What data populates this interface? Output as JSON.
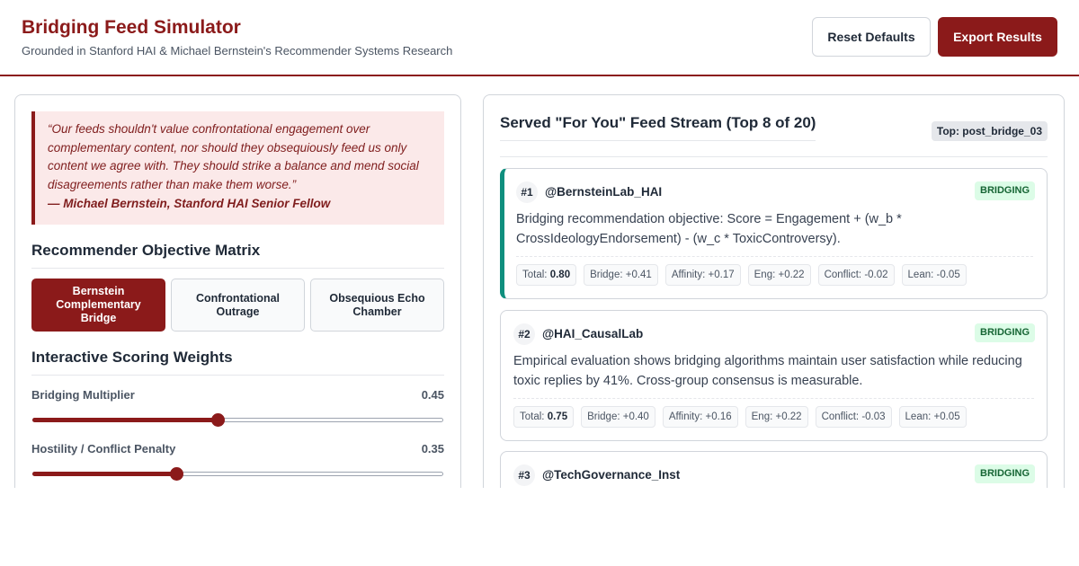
{
  "header": {
    "title": "Bridging Feed Simulator",
    "subtitle": "Grounded in Stanford HAI & Michael Bernstein's Recommender Systems Research",
    "reset_label": "Reset Defaults",
    "export_label": "Export Results"
  },
  "quote": {
    "text": "“Our feeds shouldn't value confrontational engagement over complementary content, nor should they obsequiously feed us only content we agree with. They should strike a balance and mend social disagreements rather than make them worse.”",
    "author": "— Michael Bernstein, Stanford HAI Senior Fellow"
  },
  "objectives": {
    "title": "Recommender Objective Matrix",
    "options": [
      {
        "label": "Bernstein Complementary Bridge",
        "active": true
      },
      {
        "label": "Confrontational Outrage",
        "active": false
      },
      {
        "label": "Obsequious Echo Chamber",
        "active": false
      }
    ]
  },
  "weights": {
    "title": "Interactive Scoring Weights",
    "sliders": [
      {
        "label": "Bridging Multiplier",
        "value": "0.45",
        "fraction": 0.45
      },
      {
        "label": "Hostility / Conflict Penalty",
        "value": "0.35",
        "fraction": 0.35
      }
    ]
  },
  "feed": {
    "title": "Served \"For You\" Feed Stream (Top 8 of 20)",
    "top_badge": "Top: post_bridge_03",
    "posts": [
      {
        "rank": "#1",
        "user": "@BernsteinLab_HAI",
        "badge": "BRIDGING",
        "text": "Bridging recommendation objective: Score = Engagement + (w_b * CrossIdeologyEndorsement) - (w_c * ToxicControversy).",
        "metrics": {
          "total_label": "Total:",
          "total": "0.80",
          "bridge": "Bridge: +0.41",
          "affinity": "Affinity: +0.17",
          "eng": "Eng: +0.22",
          "conflict": "Conflict: -0.02",
          "lean": "Lean: -0.05"
        }
      },
      {
        "rank": "#2",
        "user": "@HAI_CausalLab",
        "badge": "BRIDGING",
        "text": "Empirical evaluation shows bridging algorithms maintain user satisfaction while reducing toxic replies by 41%. Cross-group consensus is measurable.",
        "metrics": {
          "total_label": "Total:",
          "total": "0.75",
          "bridge": "Bridge: +0.40",
          "affinity": "Affinity: +0.16",
          "eng": "Eng: +0.22",
          "conflict": "Conflict: -0.03",
          "lean": "Lean: +0.05"
        }
      },
      {
        "rank": "#3",
        "user": "@TechGovernance_Inst",
        "badge": "BRIDGING"
      }
    ]
  },
  "colors": {
    "accent": "#8b1a1a",
    "bridging_badge_bg": "#dcfce7",
    "bridging_badge_text": "#166534",
    "featured_border": "#0f8f7e"
  }
}
